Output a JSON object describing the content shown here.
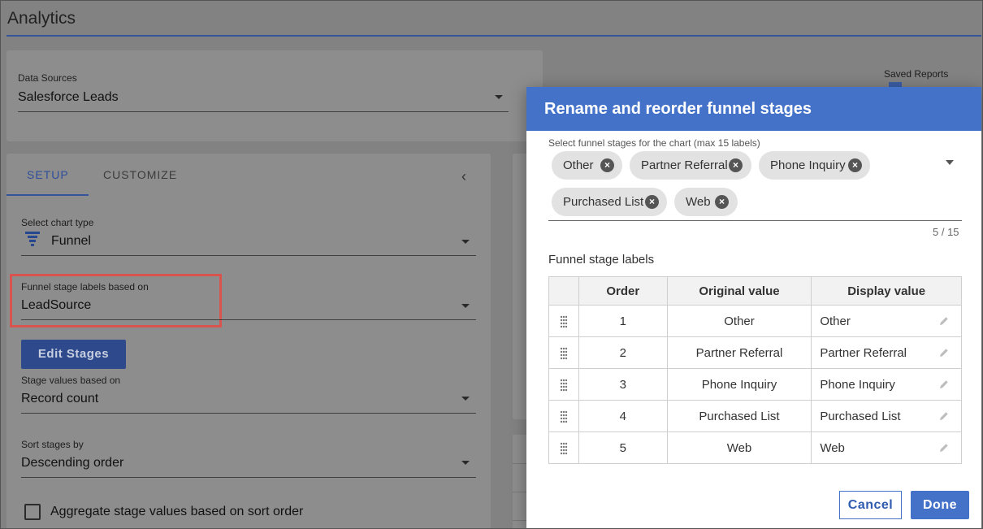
{
  "app": {
    "title": "Analytics"
  },
  "data_sources": {
    "label": "Data Sources",
    "value": "Salesforce Leads"
  },
  "saved_reports": {
    "label": "Saved Reports"
  },
  "setup": {
    "tabs": [
      {
        "label": "SETUP"
      },
      {
        "label": "CUSTOMIZE"
      }
    ],
    "chart_type": {
      "label": "Select chart type",
      "value": "Funnel"
    },
    "stage_labels": {
      "label": "Funnel stage labels based on",
      "value": "LeadSource"
    },
    "edit_stages_button": "Edit Stages",
    "stage_values": {
      "label": "Stage values based on",
      "value": "Record count"
    },
    "sort": {
      "label": "Sort stages by",
      "value": "Descending order"
    },
    "aggregate_checkbox": {
      "label": "Aggregate stage values based on sort order",
      "checked": false
    }
  },
  "modal": {
    "title": "Rename and reorder funnel stages",
    "select_label": "Select funnel stages for the chart (max 15 labels)",
    "chips": [
      "Other",
      "Partner Referral",
      "Phone Inquiry",
      "Purchased List",
      "Web"
    ],
    "counter": "5 / 15",
    "table_label": "Funnel stage labels",
    "columns": [
      "Order",
      "Original value",
      "Display value"
    ],
    "rows": [
      {
        "order": "1",
        "original": "Other",
        "display": "Other"
      },
      {
        "order": "2",
        "original": "Partner Referral",
        "display": "Partner Referral"
      },
      {
        "order": "3",
        "original": "Phone Inquiry",
        "display": "Phone Inquiry"
      },
      {
        "order": "4",
        "original": "Purchased List",
        "display": "Purchased List"
      },
      {
        "order": "5",
        "original": "Web",
        "display": "Web"
      }
    ],
    "cancel_label": "Cancel",
    "done_label": "Done"
  },
  "colors": {
    "accent": "#4472c9",
    "highlight": "#d9534f"
  }
}
